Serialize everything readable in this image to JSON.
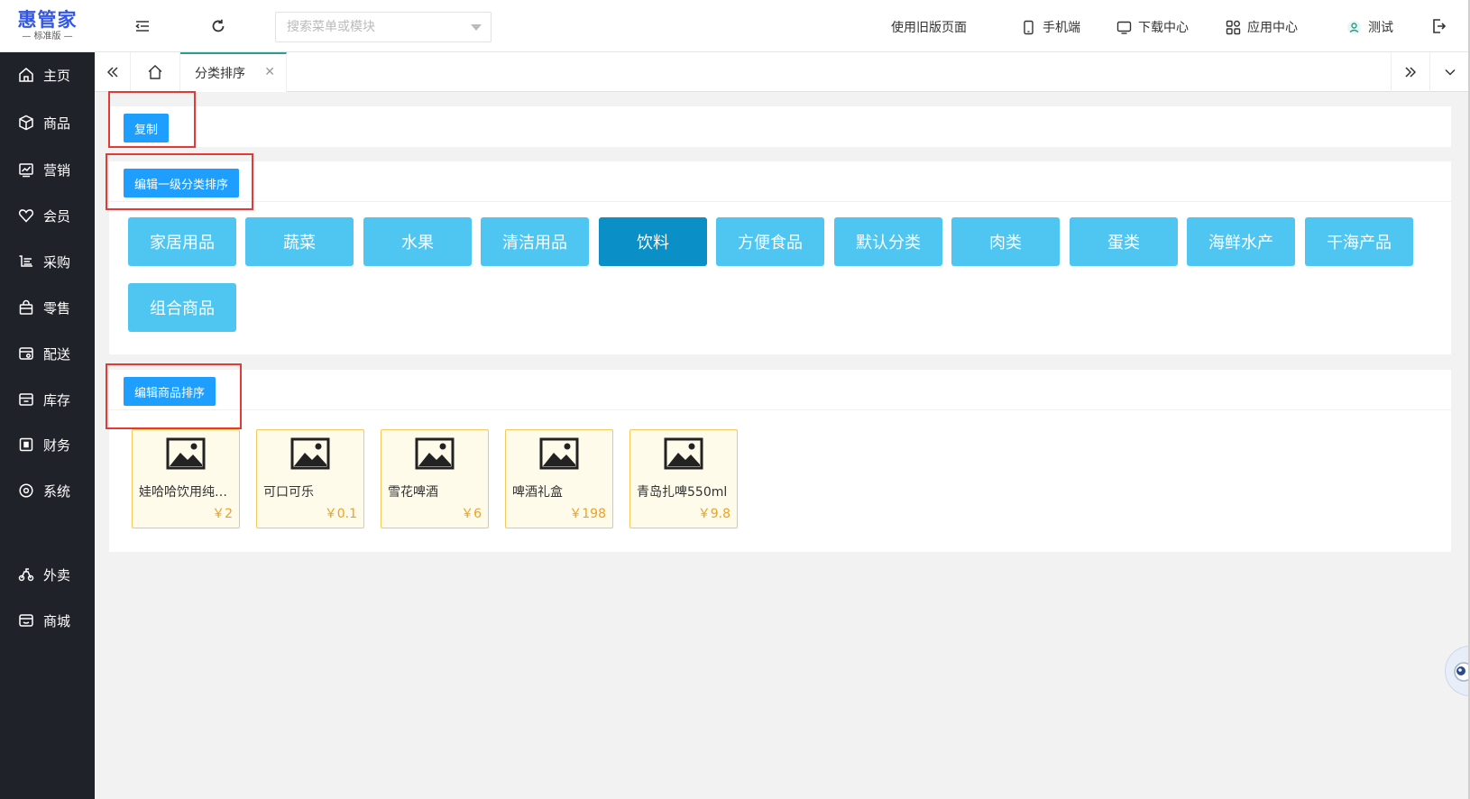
{
  "app": {
    "logo_title": "惠管家",
    "logo_sub": "— 标准版 —"
  },
  "sidebar": {
    "items": [
      {
        "label": "主页",
        "icon": "home-icon"
      },
      {
        "label": "商品",
        "icon": "box-icon"
      },
      {
        "label": "营销",
        "icon": "chart-icon"
      },
      {
        "label": "会员",
        "icon": "heart-icon"
      },
      {
        "label": "采购",
        "icon": "cart-icon"
      },
      {
        "label": "零售",
        "icon": "bag-icon"
      },
      {
        "label": "配送",
        "icon": "delivery-icon"
      },
      {
        "label": "库存",
        "icon": "inventory-icon"
      },
      {
        "label": "财务",
        "icon": "finance-icon"
      },
      {
        "label": "系统",
        "icon": "settings-icon"
      },
      {
        "label": "外卖",
        "icon": "bike-icon"
      },
      {
        "label": "商城",
        "icon": "shop-icon"
      }
    ]
  },
  "header": {
    "search_placeholder": "搜索菜单或模块",
    "old_page": "使用旧版页面",
    "mobile": "手机端",
    "download": "下载中心",
    "apps": "应用中心",
    "user": "测试"
  },
  "tabs": {
    "active_label": "分类排序"
  },
  "actions": {
    "copy": "复制",
    "edit_category_sort": "编辑一级分类排序",
    "edit_product_sort": "编辑商品排序"
  },
  "categories": [
    {
      "label": "家居用品",
      "active": false
    },
    {
      "label": "蔬菜",
      "active": false
    },
    {
      "label": "水果",
      "active": false
    },
    {
      "label": "清洁用品",
      "active": false
    },
    {
      "label": "饮料",
      "active": true
    },
    {
      "label": "方便食品",
      "active": false
    },
    {
      "label": "默认分类",
      "active": false
    },
    {
      "label": "肉类",
      "active": false
    },
    {
      "label": "蛋类",
      "active": false
    },
    {
      "label": "海鲜水产",
      "active": false
    },
    {
      "label": "干海产品",
      "active": false
    },
    {
      "label": "组合商品",
      "active": false
    }
  ],
  "products": [
    {
      "name": "娃哈哈饮用纯净水",
      "price": "￥2"
    },
    {
      "name": "可口可乐",
      "price": "￥0.1"
    },
    {
      "name": "雪花啤酒",
      "price": "￥6"
    },
    {
      "name": "啤酒礼盒",
      "price": "￥198"
    },
    {
      "name": "青岛扎啤550ml",
      "price": "￥9.8"
    }
  ],
  "colors": {
    "sidebar_bg": "#20222a",
    "primary": "#1e9fff",
    "category": "#4fc5f2",
    "category_active": "#0a8fc7",
    "price": "#f0a020",
    "highlight": "#e53935"
  }
}
